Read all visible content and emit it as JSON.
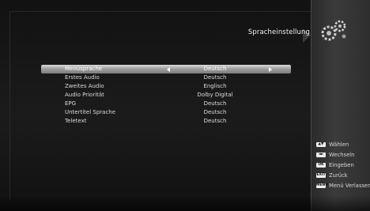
{
  "header": {
    "title": "Spracheinstellung",
    "logo_icon": "gears-icon"
  },
  "menu": {
    "items": [
      {
        "label": "Menüsprache",
        "value": "Deutsch"
      },
      {
        "label": "Erstes Audio",
        "value": "Deutsch"
      },
      {
        "label": "Zweites Audio",
        "value": "Englisch"
      },
      {
        "label": "Audio Priorität",
        "value": "Dolby Digital"
      },
      {
        "label": "EPG",
        "value": "Deutsch"
      },
      {
        "label": "Untertitel Sprache",
        "value": "Deutsch"
      },
      {
        "label": "Teletext",
        "value": "Deutsch"
      }
    ]
  },
  "help": {
    "items": [
      {
        "key": "▲▼",
        "label": "Wählen"
      },
      {
        "key": "◄►",
        "label": "Wechseln"
      },
      {
        "key": "OK",
        "label": "Eingeben"
      },
      {
        "key": "EXIT",
        "label": "Zurück"
      },
      {
        "key": "MENU",
        "label": "Menü Verlassen"
      }
    ]
  },
  "colors": {
    "selection": "#a8a8a8",
    "background": "#151515",
    "panel": "#353535"
  }
}
